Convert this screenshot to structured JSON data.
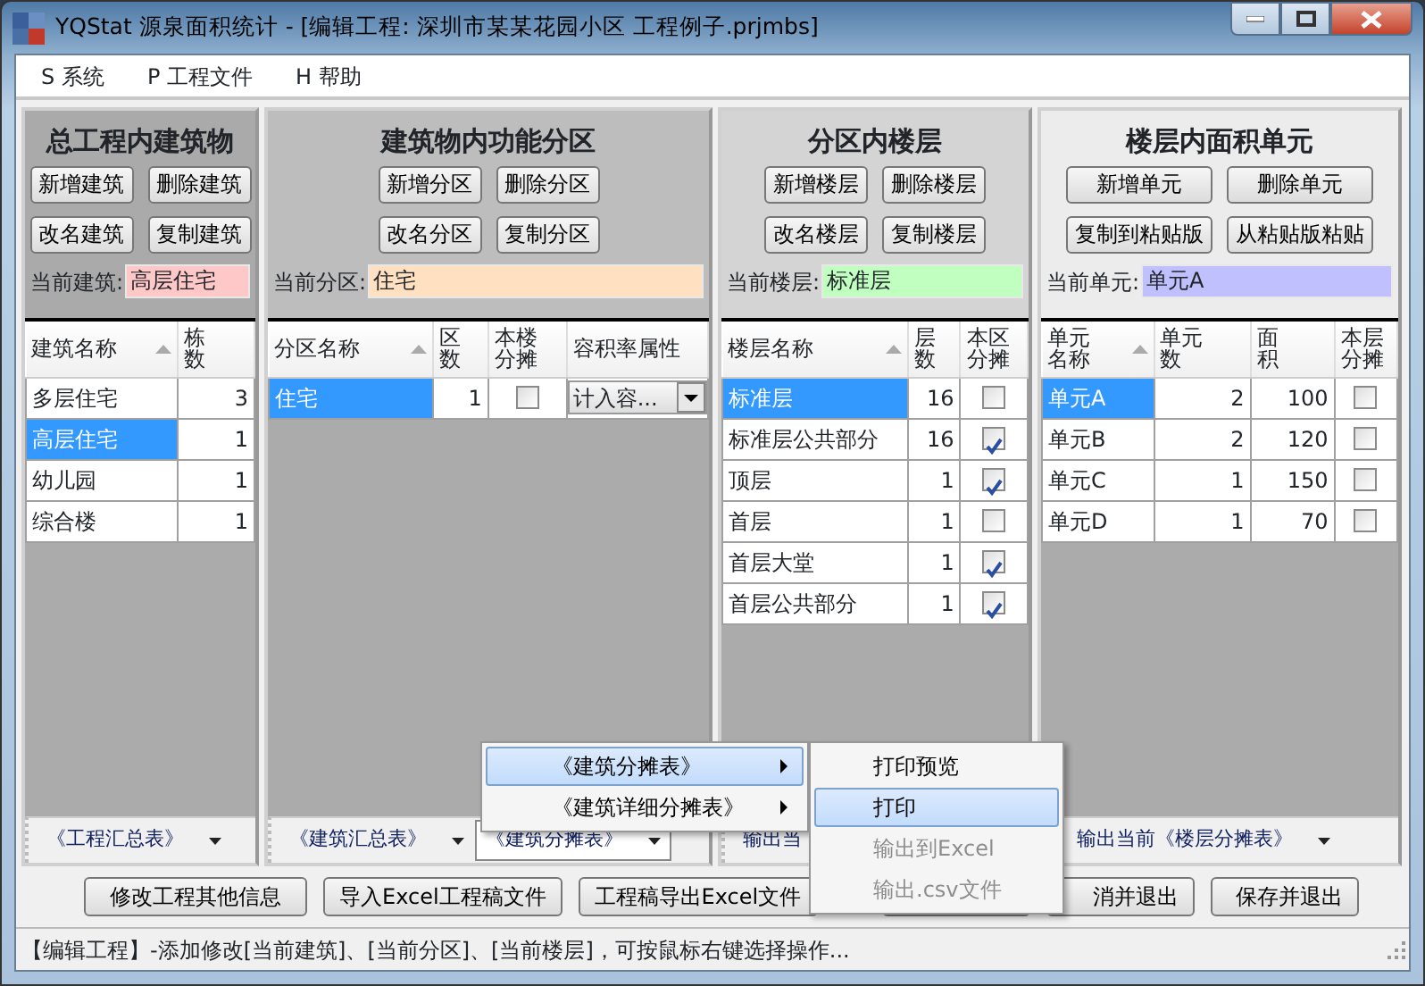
{
  "window": {
    "title": "YQStat 源泉面积统计 - [编辑工程: 深圳市某某花园小区 工程例子.prjmbs]"
  },
  "menu": [
    "S 系统",
    "P 工程文件",
    "H 帮助"
  ],
  "panels": [
    {
      "title": "总工程内建筑物",
      "buttons": [
        "新增建筑",
        "删除建筑",
        "改名建筑",
        "复制建筑"
      ],
      "current": {
        "label": "当前建筑:",
        "value": "高层住宅",
        "color": "#ffc8c8"
      },
      "columns": [
        {
          "label": "建筑名称",
          "sorted": true
        },
        {
          "label": "栋数",
          "sorted": false
        }
      ],
      "rows": [
        {
          "selected": false,
          "cells": [
            "多层住宅",
            "3"
          ]
        },
        {
          "selected": true,
          "cells": [
            "高层住宅",
            "1"
          ]
        },
        {
          "selected": false,
          "cells": [
            "幼儿园",
            "1"
          ]
        },
        {
          "selected": false,
          "cells": [
            "综合楼",
            "1"
          ]
        }
      ],
      "tools": [
        {
          "label": "《工程汇总表》",
          "open": false,
          "caret": true
        }
      ]
    },
    {
      "title": "建筑物内功能分区",
      "buttons": [
        "新增分区",
        "删除分区",
        "改名分区",
        "复制分区"
      ],
      "current": {
        "label": "当前分区:",
        "value": "住宅",
        "color": "#ffe0c0"
      },
      "columns": [
        {
          "label": "分区名称",
          "sorted": true
        },
        {
          "label": "区数",
          "sorted": false
        },
        {
          "label": "本楼分摊",
          "sorted": false
        },
        {
          "label": "容积率属性",
          "sorted": false
        }
      ],
      "rows": [
        {
          "selected": true,
          "cells": [
            "住宅",
            "1",
            {
              "kind": "check",
              "checked": false
            },
            {
              "kind": "combo",
              "value": "计入容..."
            }
          ]
        }
      ],
      "tools": [
        {
          "label": "《建筑汇总表》",
          "open": false,
          "caret": true
        },
        {
          "label": "《建筑分摊表》",
          "open": true,
          "caret": true
        }
      ]
    },
    {
      "title": "分区内楼层",
      "buttons": [
        "新增楼层",
        "删除楼层",
        "改名楼层",
        "复制楼层"
      ],
      "current": {
        "label": "当前楼层:",
        "value": "标准层",
        "color": "#c0ffc0"
      },
      "columns": [
        {
          "label": "楼层名称",
          "sorted": true
        },
        {
          "label": "层数",
          "sorted": false
        },
        {
          "label": "本区分摊",
          "sorted": false
        }
      ],
      "rows": [
        {
          "selected": true,
          "cells": [
            "标准层",
            "16",
            {
              "kind": "check",
              "checked": false
            }
          ]
        },
        {
          "selected": false,
          "cells": [
            "标准层公共部分",
            "16",
            {
              "kind": "check",
              "checked": true
            }
          ]
        },
        {
          "selected": false,
          "cells": [
            "顶层",
            "1",
            {
              "kind": "check",
              "checked": true
            }
          ]
        },
        {
          "selected": false,
          "cells": [
            "首层",
            "1",
            {
              "kind": "check",
              "checked": false
            }
          ]
        },
        {
          "selected": false,
          "cells": [
            "首层大堂",
            "1",
            {
              "kind": "check",
              "checked": true
            }
          ]
        },
        {
          "selected": false,
          "cells": [
            "首层公共部分",
            "1",
            {
              "kind": "check",
              "checked": true
            }
          ]
        }
      ],
      "tools": [
        {
          "label": "输出当",
          "open": false,
          "caret": false
        }
      ]
    },
    {
      "title": "楼层内面积单元",
      "buttons": [
        "新增单元",
        "删除单元",
        "复制到粘贴版",
        "从粘贴版粘贴"
      ],
      "current": {
        "label": "当前单元:",
        "value": "单元A",
        "color": "#c0c0ff"
      },
      "columns": [
        {
          "label": "单元名称",
          "sorted": true
        },
        {
          "label": "单元数",
          "sorted": false
        },
        {
          "label": "面积",
          "sorted": false
        },
        {
          "label": "本层分摊",
          "sorted": false
        }
      ],
      "rows": [
        {
          "selected": true,
          "cells": [
            "单元A",
            "2",
            "100",
            {
              "kind": "check",
              "checked": false
            }
          ]
        },
        {
          "selected": false,
          "cells": [
            "单元B",
            "2",
            "120",
            {
              "kind": "check",
              "checked": false
            }
          ]
        },
        {
          "selected": false,
          "cells": [
            "单元C",
            "1",
            "150",
            {
              "kind": "check",
              "checked": false
            }
          ]
        },
        {
          "selected": false,
          "cells": [
            "单元D",
            "1",
            "70",
            {
              "kind": "check",
              "checked": false
            }
          ]
        }
      ],
      "tools": [
        {
          "label": "输出当前《楼层分摊表》",
          "open": false,
          "caret": true
        }
      ]
    }
  ],
  "buttons_left": [
    "修改工程其他信息",
    "导入Excel工程稿文件",
    "工程稿导出Excel文件"
  ],
  "buttons_right": [
    "消并退出",
    "保存并退出"
  ],
  "menus": [
    {
      "items": [
        {
          "label": "《建筑分摊表》",
          "selected": true,
          "submenu": true
        },
        {
          "label": "《建筑详细分摊表》",
          "selected": false,
          "submenu": true
        }
      ]
    },
    {
      "items": [
        {
          "label": "打印预览",
          "selected": false,
          "disabled": false
        },
        {
          "label": "打印",
          "selected": true,
          "disabled": false
        },
        {
          "label": "输出到Excel",
          "selected": false,
          "disabled": true
        },
        {
          "label": "输出.csv文件",
          "selected": false,
          "disabled": true
        }
      ]
    }
  ],
  "status_bar": "【编辑工程】-添加修改[当前建筑]、[当前分区]、[当前楼层]，可按鼠标右键选择操作..."
}
